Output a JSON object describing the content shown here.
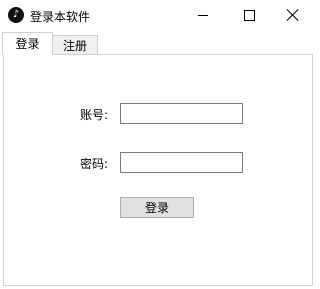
{
  "window": {
    "title": "登录本软件",
    "icon": "tiktok-logo-icon",
    "icon_glyph": "♪"
  },
  "tabs": [
    {
      "label": "登录",
      "selected": true
    },
    {
      "label": "注册",
      "selected": false
    }
  ],
  "form": {
    "account_label": "账号:",
    "account_value": "",
    "password_label": "密码:",
    "password_value": "",
    "login_button": "登录"
  }
}
